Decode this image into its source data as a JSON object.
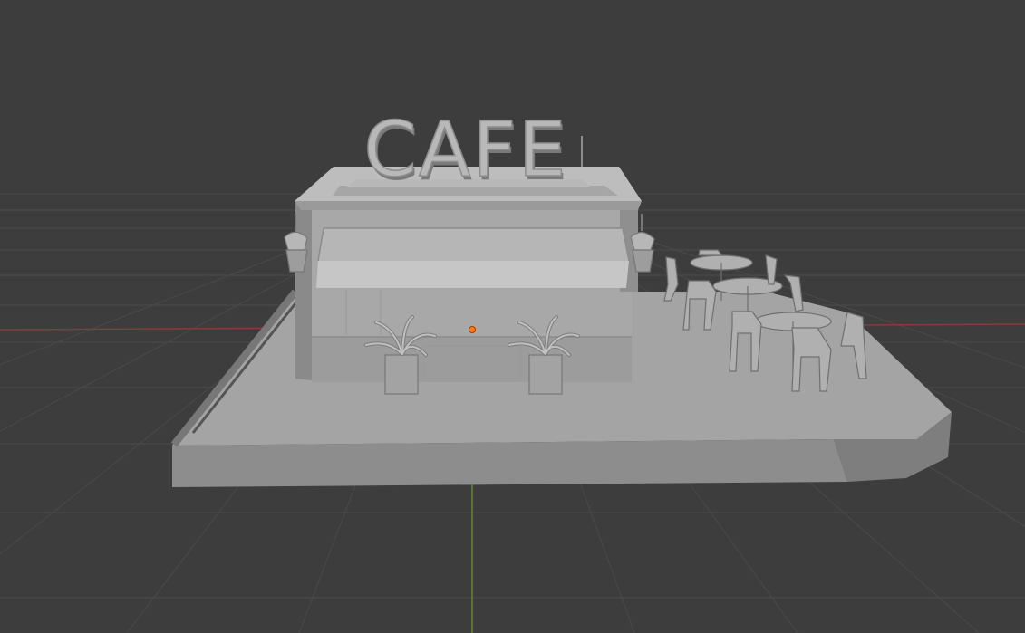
{
  "viewport": {
    "background_color": "#3d3d3d",
    "grid_color": "#4a4a4a",
    "x_axis_color": "#8a3a3a",
    "y_axis_color": "#5f8a2e",
    "origin_color": "#ff7a1a"
  },
  "model": {
    "sign": {
      "text": "CAFE"
    },
    "material_color": "#a8a8a8",
    "shadow_color": "#7f7f7f",
    "highlight_color": "#c4c4c4"
  }
}
